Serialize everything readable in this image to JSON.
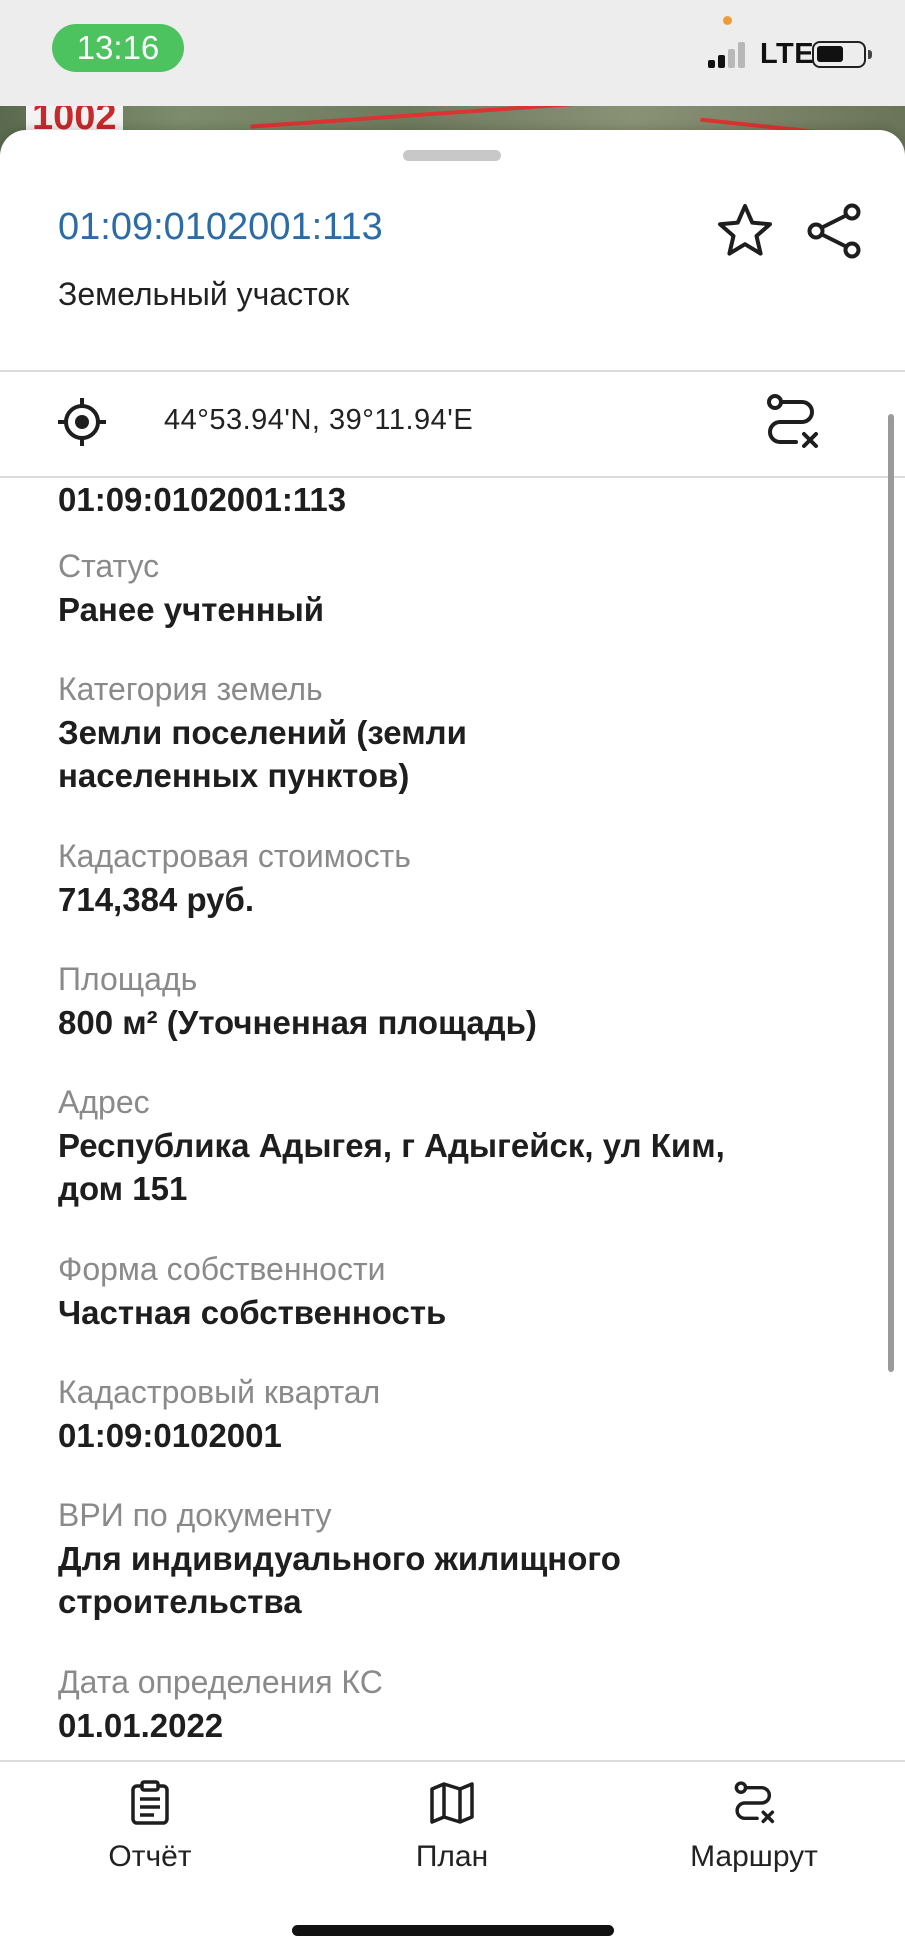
{
  "status_bar": {
    "time": "13:16",
    "network": "LTE"
  },
  "map_peek": {
    "label": "1002"
  },
  "header": {
    "cadastral_number": "01:09:0102001:113",
    "object_type": "Земельный участок"
  },
  "coords": {
    "text": "44°53.94'N, 39°11.94'E"
  },
  "first_value": "01:09:0102001:113",
  "fields": [
    {
      "label": "Статус",
      "value": "Ранее учтенный"
    },
    {
      "label": "Категория земель",
      "value_lines": [
        "Земли поселений (земли",
        "населенных пунктов)"
      ]
    },
    {
      "label": "Кадастровая стоимость",
      "value": "714,384 руб."
    },
    {
      "label": "Площадь",
      "value": "800 м² (Уточненная площадь)"
    },
    {
      "label": "Адрес",
      "value_lines": [
        "Республика Адыгея, г Адыгейск, ул Ким,",
        "дом 151"
      ]
    },
    {
      "label": "Форма собственности",
      "value": "Частная собственность"
    },
    {
      "label": "Кадастровый квартал",
      "value": "01:09:0102001"
    },
    {
      "label": "ВРИ по документу",
      "value_lines": [
        "Для индивидуального жилищного",
        "строительства"
      ]
    },
    {
      "label": "Дата определения КС",
      "value": "01.01.2022"
    }
  ],
  "tabs": {
    "report": "Отчёт",
    "plan": "План",
    "route": "Маршрут"
  },
  "colors": {
    "accent_link": "#2d6ba6",
    "status_pill": "#4cc35e"
  },
  "icons": [
    "star-icon",
    "share-icon",
    "target-icon",
    "route-clear-icon",
    "clipboard-icon",
    "map-icon",
    "route-icon"
  ]
}
